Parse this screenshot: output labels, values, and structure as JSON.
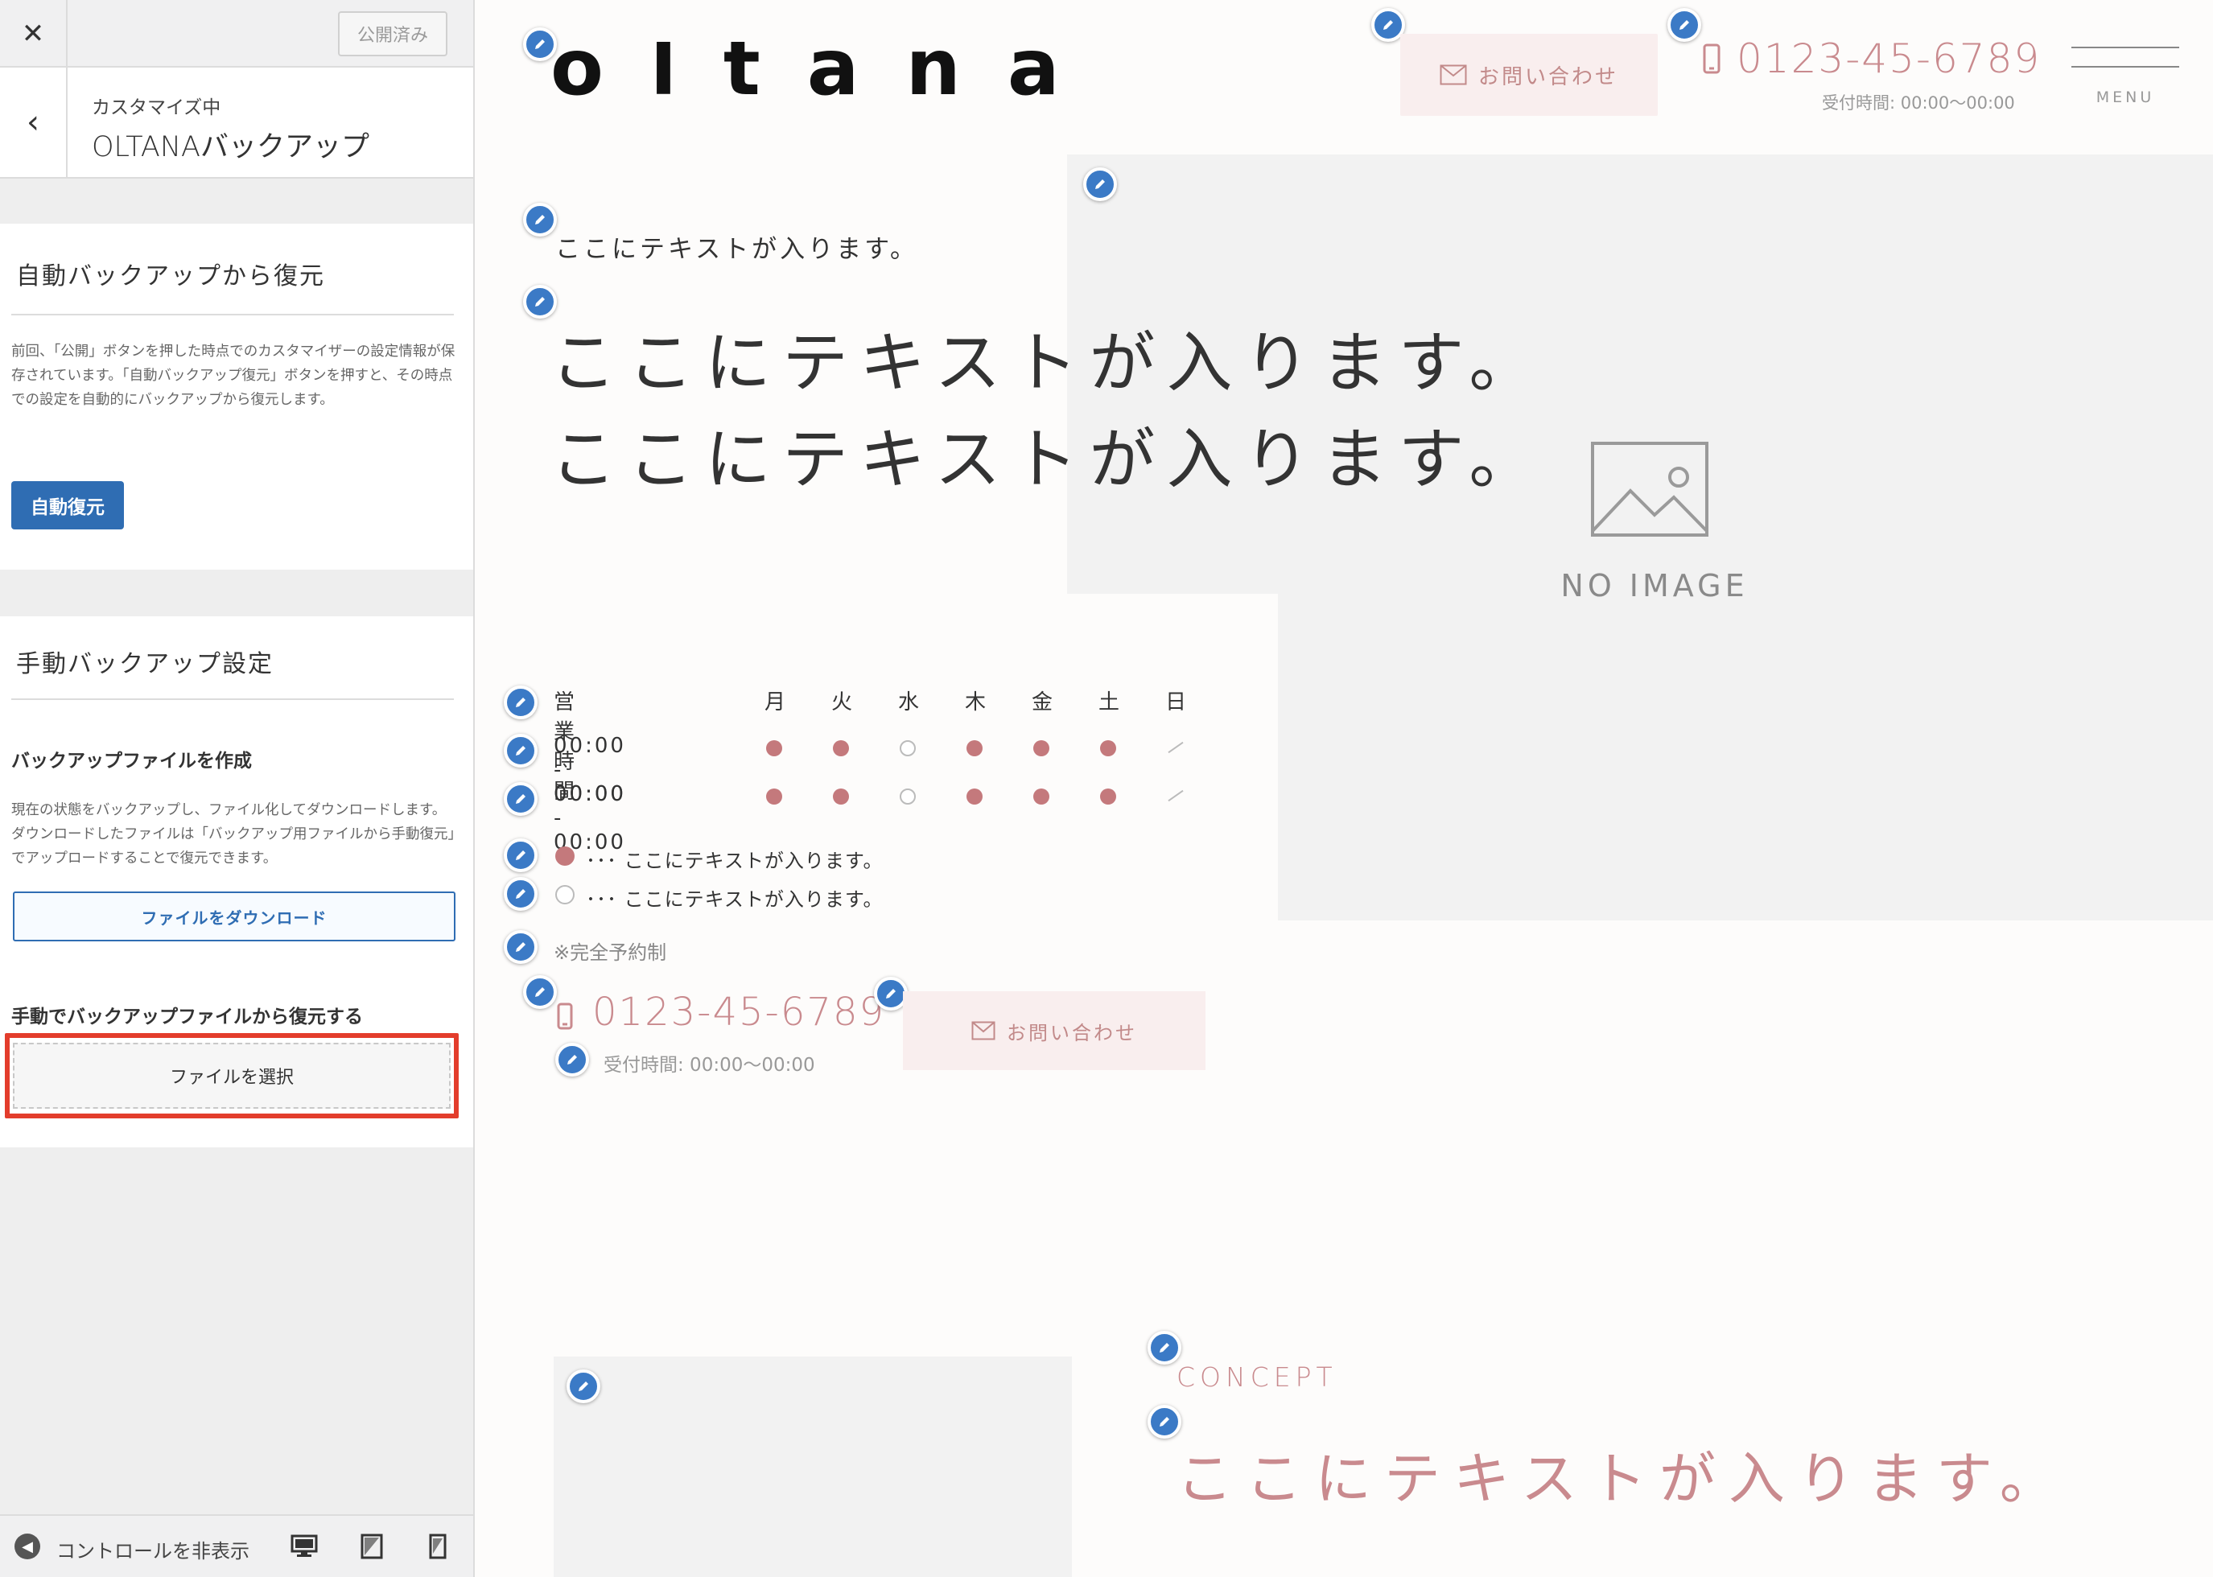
{
  "sidebar": {
    "close_icon": "close-icon",
    "publish_label": "公開済み",
    "customizing_label": "カスタマイズ中",
    "panel_title": "OLTANAバックアップ",
    "auto_section": {
      "title": "自動バックアップから復元",
      "description": "前回、「公開」ボタンを押した時点でのカスタマイザーの設定情報が保存されています。「自動バックアップ復元」ボタンを押すと、その時点での設定を自動的にバックアップから復元します。",
      "button_label": "自動復元"
    },
    "manual_section": {
      "title": "手動バックアップ設定",
      "create_label": "バックアップファイルを作成",
      "create_description": "現在の状態をバックアップし、ファイル化してダウンロードします。ダウンロードしたファイルは「バックアップ用ファイルから手動復元」でアップロードすることで復元できます。",
      "download_label": "ファイルをダウンロード",
      "restore_label": "手動でバックアップファイルから復元する",
      "file_select_label": "ファイルを選択"
    },
    "footer": {
      "hide_controls_label": "コントロールを非表示"
    }
  },
  "preview": {
    "logo_text": "oltana",
    "contact_label": "お問い合わせ",
    "phone": "0123-45-6789",
    "reception_hours": "受付時間: 00:00〜00:00",
    "menu_label": "MENU",
    "no_image_label": "NO IMAGE",
    "hero_small_text": "ここにテキストが入ります。",
    "hero_big_lines": [
      "ここにテキストが入ります。",
      "ここにテキストが入ります。"
    ],
    "hours_table": {
      "header": "営業時間",
      "days": [
        "月",
        "火",
        "水",
        "木",
        "金",
        "土",
        "日"
      ],
      "rows": [
        {
          "time": "00:00 - 00:00",
          "marks": [
            "open",
            "open",
            "closed",
            "open",
            "open",
            "open",
            "none"
          ]
        },
        {
          "time": "00:00 - 00:00",
          "marks": [
            "open",
            "open",
            "closed",
            "open",
            "open",
            "open",
            "none"
          ]
        }
      ]
    },
    "legend": [
      {
        "mark": "open",
        "text": "･･･ ここにテキストが入ります。"
      },
      {
        "mark": "closed",
        "text": "･･･ ここにテキストが入ります。"
      }
    ],
    "note": "※完全予約制",
    "concept_label": "CONCEPT",
    "concept_text": "ここにテキストが入ります。"
  },
  "colors": {
    "accent_blue": "#2f6db3",
    "brand_pink": "#c98a8e",
    "highlight_red": "#e33d2c"
  }
}
